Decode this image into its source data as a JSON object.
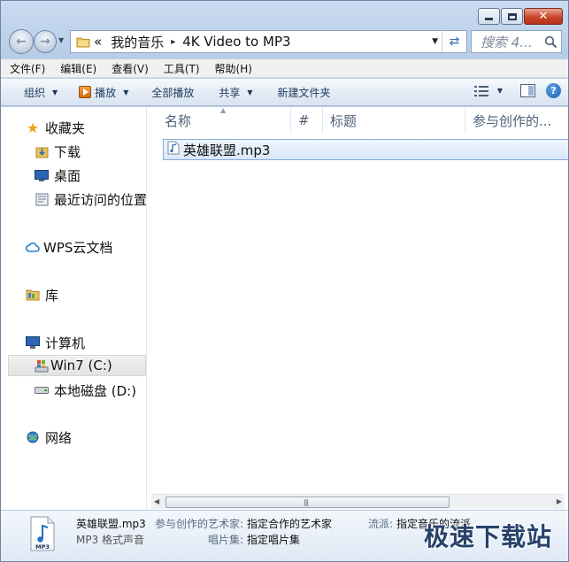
{
  "window": {
    "caption_buttons": {
      "minimize": "minimize",
      "maximize": "maximize",
      "close": "close"
    }
  },
  "address": {
    "overflow": "«",
    "crumbs": [
      "我的音乐",
      "4K Video to MP3"
    ],
    "separator": "▸"
  },
  "search": {
    "placeholder": "搜索 4..."
  },
  "menu": [
    "文件(F)",
    "编辑(E)",
    "查看(V)",
    "工具(T)",
    "帮助(H)"
  ],
  "toolbar": {
    "organize": "组织",
    "play": "播放",
    "play_all": "全部播放",
    "share": "共享",
    "new_folder": "新建文件夹"
  },
  "nav": {
    "favorites": "收藏夹",
    "downloads": "下载",
    "desktop": "桌面",
    "recent": "最近访问的位置",
    "wps": "WPS云文档",
    "libraries": "库",
    "computer": "计算机",
    "drive_c": "Win7 (C:)",
    "drive_d": "本地磁盘 (D:)",
    "network": "网络"
  },
  "columns": [
    "名称",
    "#",
    "标题",
    "参与创作的..."
  ],
  "files": [
    {
      "name": "英雄联盟.mp3",
      "icon": "audio-file-icon"
    }
  ],
  "details": {
    "file_name": "英雄联盟.mp3",
    "file_type": "MP3 格式声音",
    "icon_label": "MP3",
    "artist_label": "参与创作的艺术家:",
    "artist_value": "指定合作的艺术家",
    "album_label": "唱片集:",
    "album_value": "指定唱片集",
    "genre_label": "流派:",
    "genre_value": "指定音乐的流派"
  },
  "watermark": "极速下载站",
  "colors": {
    "accent": "#1e395b",
    "selection": "#d9e8f9",
    "chrome": "#c9dbf0"
  }
}
